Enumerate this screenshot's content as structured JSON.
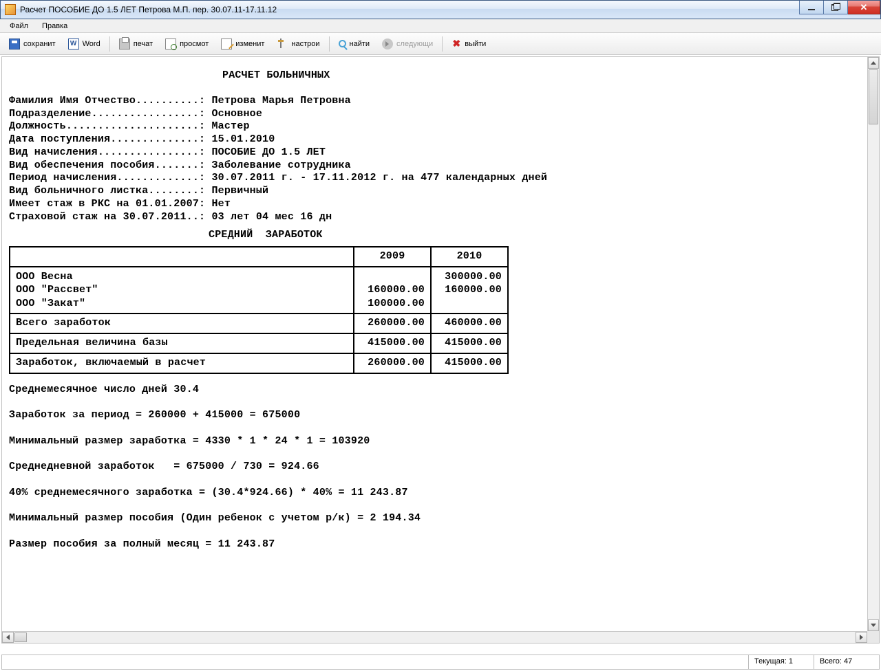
{
  "window": {
    "title": "Расчет ПОСОБИЕ ДО 1.5 ЛЕТ Петрова М.П. пер. 30.07.11-17.11.12"
  },
  "menubar": {
    "file": "Файл",
    "edit": "Правка"
  },
  "toolbar": {
    "save": "сохранит",
    "word": "Word",
    "print": "печат",
    "preview": "просмот",
    "edit": "изменит",
    "settings": "настрои",
    "find": "найти",
    "next": "следующи",
    "exit": "выйти"
  },
  "doc": {
    "heading1": "РАСЧЕТ БОЛЬНИЧНЫХ",
    "rows": {
      "r1": "Фамилия Имя Отчество..........: Петрова Марья Петровна",
      "r2": "Подразделение.................: Основное",
      "r3": "Должность.....................: Мастер",
      "r4": "Дата поступления..............: 15.01.2010",
      "r5": "Вид начисления................: ПОСОБИЕ ДО 1.5 ЛЕТ",
      "r6": "Вид обеспечения пособия.......: Заболевание сотрудника",
      "r7": "Период начисления.............: 30.07.2011 г. - 17.11.2012 г. на 477 календарных дней",
      "r8": "Вид больничного листка........: Первичный",
      "r9": "Имеет стаж в РКС на 01.01.2007: Нет",
      "r10": "Страховой стаж на 30.07.2011..: 03 лет 04 мес 16 дн"
    },
    "heading2": "СРЕДНИЙ  ЗАРАБОТОК",
    "table": {
      "col1": "2009",
      "col2": "2010",
      "orgs": "ООО Весна\nООО \"Рассвет\"\nООО \"Закат\"",
      "orgs_2009": "\n160000.00\n100000.00",
      "orgs_2010": "300000.00\n160000.00\n",
      "total_label": "Всего заработок",
      "total_2009": "260000.00",
      "total_2010": "460000.00",
      "limit_label": "Предельная величина базы",
      "limit_2009": "415000.00",
      "limit_2010": "415000.00",
      "incl_label": "Заработок, включаемый в расчет",
      "incl_2009": "260000.00",
      "incl_2010": "415000.00"
    },
    "calc": {
      "c1": "Среднемесячное число дней 30.4",
      "c2": "Заработок за период = 260000 + 415000 = 675000",
      "c3": "Минимальный размер заработка = 4330 * 1 * 24 * 1 = 103920",
      "c4": "Среднедневной заработок   = 675000 / 730 = 924.66",
      "c5": "40% среднемесячного заработка = (30.4*924.66) * 40% = 11 243.87",
      "c6": "Минимальный размер пособия (Один ребенок с учетом р/к) = 2 194.34",
      "c7": "Размер пособия за полный месяц = 11 243.87"
    }
  },
  "statusbar": {
    "current_label": "Текущая:",
    "current_value": "1",
    "total_label": "Всего:",
    "total_value": "47"
  }
}
